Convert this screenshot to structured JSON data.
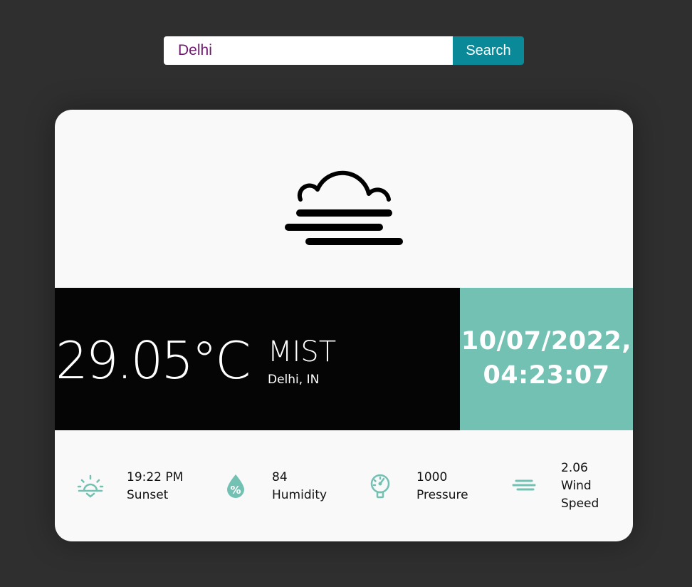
{
  "search": {
    "value": "Delhi",
    "button_label": "Search"
  },
  "weather": {
    "icon": "mist-icon",
    "temperature": "29.05°C",
    "condition": "MIST",
    "location": "Delhi, IN",
    "date": "10/07/2022,",
    "time": "04:23:07"
  },
  "stats": {
    "sunset": {
      "value": "19:22 PM",
      "label": "Sunset",
      "icon": "sunset-icon"
    },
    "humidity": {
      "value": "84",
      "label": "Humidity",
      "icon": "humidity-icon"
    },
    "pressure": {
      "value": "1000",
      "label": "Pressure",
      "icon": "pressure-gauge-icon"
    },
    "wind": {
      "value": "2.06",
      "label_line1": "Wind",
      "label_line2": "Speed",
      "icon": "wind-icon"
    }
  },
  "colors": {
    "background": "#2f2f2f",
    "accent": "#72c1b3",
    "search_button": "#0a8a99",
    "temp_panel": "#060505",
    "card": "#f9f9f9"
  }
}
